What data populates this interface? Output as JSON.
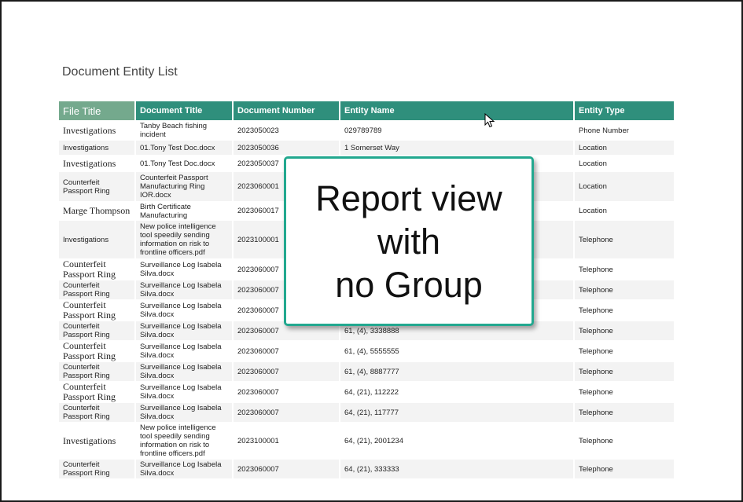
{
  "report": {
    "title": "Document Entity List",
    "columns": [
      "File Title",
      "Document Title",
      "Document Number",
      "Entity Name",
      "Entity Type"
    ],
    "rows": [
      {
        "file_title": "Investigations",
        "doc_title": "Tanby Beach fishing incident",
        "doc_number": "2023050023",
        "entity_name": "029789789",
        "entity_type": "Phone Number",
        "serif": true
      },
      {
        "file_title": "Investigations",
        "doc_title": "01.Tony Test Doc.docx",
        "doc_number": "2023050036",
        "entity_name": "1 Somerset Way",
        "entity_type": "Location",
        "serif": false
      },
      {
        "file_title": "Investigations",
        "doc_title": "01.Tony Test Doc.docx",
        "doc_number": "2023050037",
        "entity_name": "",
        "entity_type": "Location",
        "serif": true
      },
      {
        "file_title": "Counterfeit Passport Ring",
        "doc_title": "Counterfeit Passport Manufacturing Ring IOR.docx",
        "doc_number": "2023060001",
        "entity_name": "",
        "entity_type": "Location",
        "serif": false
      },
      {
        "file_title": "Marge Thompson",
        "doc_title": "Birth Certificate Manufacturing",
        "doc_number": "2023060017",
        "entity_name": "",
        "entity_type": "Location",
        "serif": true
      },
      {
        "file_title": "Investigations",
        "doc_title": "New police intelligence tool speedily sending information on risk to frontline officers.pdf",
        "doc_number": "2023100001",
        "entity_name": "",
        "entity_type": "Telephone",
        "serif": false
      },
      {
        "file_title": "Counterfeit Passport Ring",
        "doc_title": "Surveillance Log Isabela Silva.docx",
        "doc_number": "2023060007",
        "entity_name": "",
        "entity_type": "Telephone",
        "serif": true
      },
      {
        "file_title": "Counterfeit Passport Ring",
        "doc_title": "Surveillance Log Isabela Silva.docx",
        "doc_number": "2023060007",
        "entity_name": "",
        "entity_type": "Telephone",
        "serif": false
      },
      {
        "file_title": "Counterfeit Passport Ring",
        "doc_title": "Surveillance Log Isabela Silva.docx",
        "doc_number": "2023060007",
        "entity_name": "",
        "entity_type": "Telephone",
        "serif": true
      },
      {
        "file_title": "Counterfeit Passport Ring",
        "doc_title": "Surveillance Log Isabela Silva.docx",
        "doc_number": "2023060007",
        "entity_name": "61, (4), 3338888",
        "entity_type": "Telephone",
        "serif": false
      },
      {
        "file_title": "Counterfeit Passport Ring",
        "doc_title": "Surveillance Log Isabela Silva.docx",
        "doc_number": "2023060007",
        "entity_name": "61, (4), 5555555",
        "entity_type": "Telephone",
        "serif": true
      },
      {
        "file_title": "Counterfeit Passport Ring",
        "doc_title": "Surveillance Log Isabela Silva.docx",
        "doc_number": "2023060007",
        "entity_name": "61, (4), 8887777",
        "entity_type": "Telephone",
        "serif": false
      },
      {
        "file_title": "Counterfeit Passport Ring",
        "doc_title": "Surveillance Log Isabela Silva.docx",
        "doc_number": "2023060007",
        "entity_name": "64, (21), 112222",
        "entity_type": "Telephone",
        "serif": true
      },
      {
        "file_title": "Counterfeit Passport Ring",
        "doc_title": "Surveillance Log Isabela Silva.docx",
        "doc_number": "2023060007",
        "entity_name": "64, (21), 117777",
        "entity_type": "Telephone",
        "serif": false
      },
      {
        "file_title": "Investigations",
        "doc_title": "New police intelligence tool speedily sending information on risk to frontline officers.pdf",
        "doc_number": "2023100001",
        "entity_name": "64, (21), 2001234",
        "entity_type": "Telephone",
        "serif": true
      },
      {
        "file_title": "Counterfeit Passport Ring",
        "doc_title": "Surveillance Log Isabela Silva.docx",
        "doc_number": "2023060007",
        "entity_name": "64, (21), 333333",
        "entity_type": "Telephone",
        "serif": false
      }
    ]
  },
  "overlay": {
    "text": "Report view\nwith\nno Group"
  },
  "colors": {
    "header_bg": "#2f8f7c",
    "first_header_bg": "#74a98d",
    "overlay_border": "#22a88f",
    "alt_row_bg": "#f3f3f3"
  },
  "icons": {
    "cursor": "mouse-pointer-icon"
  }
}
